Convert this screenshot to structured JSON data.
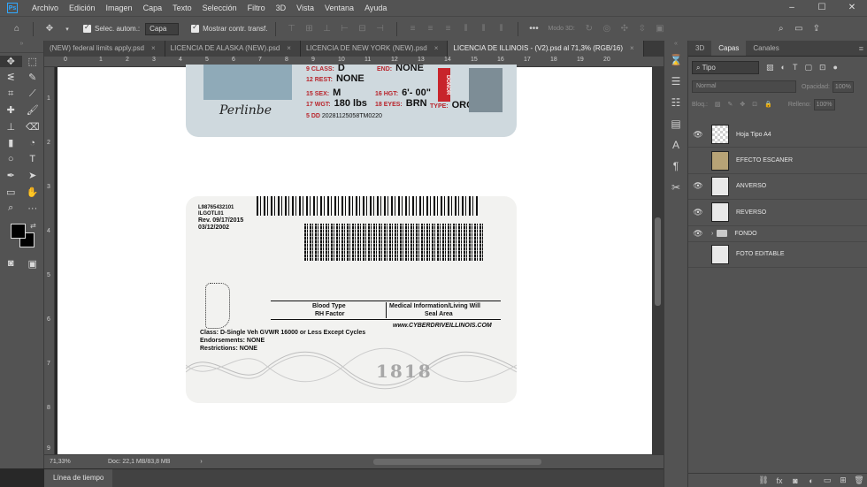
{
  "app": {
    "logo": "Ps"
  },
  "menu": [
    "Archivo",
    "Edición",
    "Imagen",
    "Capa",
    "Texto",
    "Selección",
    "Filtro",
    "3D",
    "Vista",
    "Ventana",
    "Ayuda"
  ],
  "window_controls": [
    "–",
    "☐",
    "✕"
  ],
  "options": {
    "auto_select_label": "Selec. autom.:",
    "auto_select_target": "Capa",
    "show_transform_label": "Mostrar contr. transf.",
    "mode3d_label": "Modo 3D:",
    "more": "•••"
  },
  "tabs": [
    {
      "label": "(NEW) federal limits apply.psd",
      "close": "×"
    },
    {
      "label": "LICENCIA DE ALASKA (NEW).psd",
      "close": "×"
    },
    {
      "label": "LICENCIA DE NEW YORK (NEW).psd",
      "close": "×"
    },
    {
      "label": "LICENCIA DE ILLINOIS - (V2).psd al 71,3% (RGB/16)",
      "close": "×"
    }
  ],
  "rulers": {
    "top": [
      "0",
      "1",
      "2",
      "3",
      "4",
      "5",
      "6",
      "7",
      "8",
      "9",
      "10",
      "11",
      "12",
      "13",
      "14",
      "15",
      "16",
      "17",
      "18",
      "19",
      "20"
    ],
    "left": [
      "1",
      "2",
      "3",
      "4",
      "5",
      "6",
      "7",
      "8",
      "9"
    ]
  },
  "card_front": {
    "class_label": "9  CLASS:",
    "class_value": "D",
    "end_label": "END:",
    "end_value": "NONE",
    "rest_label": "12  REST:",
    "rest_value": "NONE",
    "sex_label": "15  SEX:",
    "sex_value": "M",
    "hgt_label": "16  HGT:",
    "hgt_value": "6'- 00\"",
    "wgt_label": "17  WGT:",
    "wgt_value": "180 lbs",
    "eyes_label": "18  EYES:",
    "eyes_value": "BRN",
    "type_label": "TYPE:",
    "type_value": "ORG",
    "dd_label": "5  DD",
    "dd_value": "20281125058TM0220",
    "donor": "DONOR",
    "signature": "Perlinbe"
  },
  "card_back": {
    "id_line1": "L98765432101",
    "id_line2": "ILGOTL01",
    "rev": "Rev. 09/17/2015",
    "date": "03/12/2002",
    "blood_type": "Blood Type",
    "rh_factor": "RH Factor",
    "medical": "Medical Information/Living Will",
    "seal_area": "Seal Area",
    "website": "www.CYBERDRIVEILLINOIS.COM",
    "class_line": "Class: D-Single Veh GVWR 16000 or Less Except Cycles",
    "endorsements": "Endorsements: NONE",
    "restrictions": "Restrictions: NONE",
    "year": "1818"
  },
  "status": {
    "zoom": "71,33%",
    "doc": "Doc: 22,1 MB/83,8 MB",
    "arrow": "›"
  },
  "timeline_label": "Línea de tiempo",
  "panel": {
    "tabs": [
      "3D",
      "Capas",
      "Canales"
    ],
    "active_tab": "Capas",
    "filter": "Tipo",
    "blend_mode": "Normal",
    "opacity_label": "Opacidad:",
    "opacity_value": "100%",
    "lock_label": "Bloq.:",
    "fill_label": "Relleno:",
    "fill_value": "100%"
  },
  "layers": [
    {
      "name": "Hoja Tipo A4",
      "visible": true,
      "thumb": "checker"
    },
    {
      "name": "EFECTO ESCANER",
      "visible": false,
      "thumb": "tan"
    },
    {
      "name": "ANVERSO",
      "visible": true,
      "thumb": "doc"
    },
    {
      "name": "REVERSO",
      "visible": true,
      "thumb": "doc"
    },
    {
      "name": "FONDO",
      "visible": true,
      "thumb": "group"
    },
    {
      "name": "FOTO EDITABLE",
      "visible": false,
      "thumb": "doc"
    }
  ],
  "colors": {
    "chrome": "#535353",
    "accent": "#31a8ff",
    "donor_red": "#c8242b"
  }
}
